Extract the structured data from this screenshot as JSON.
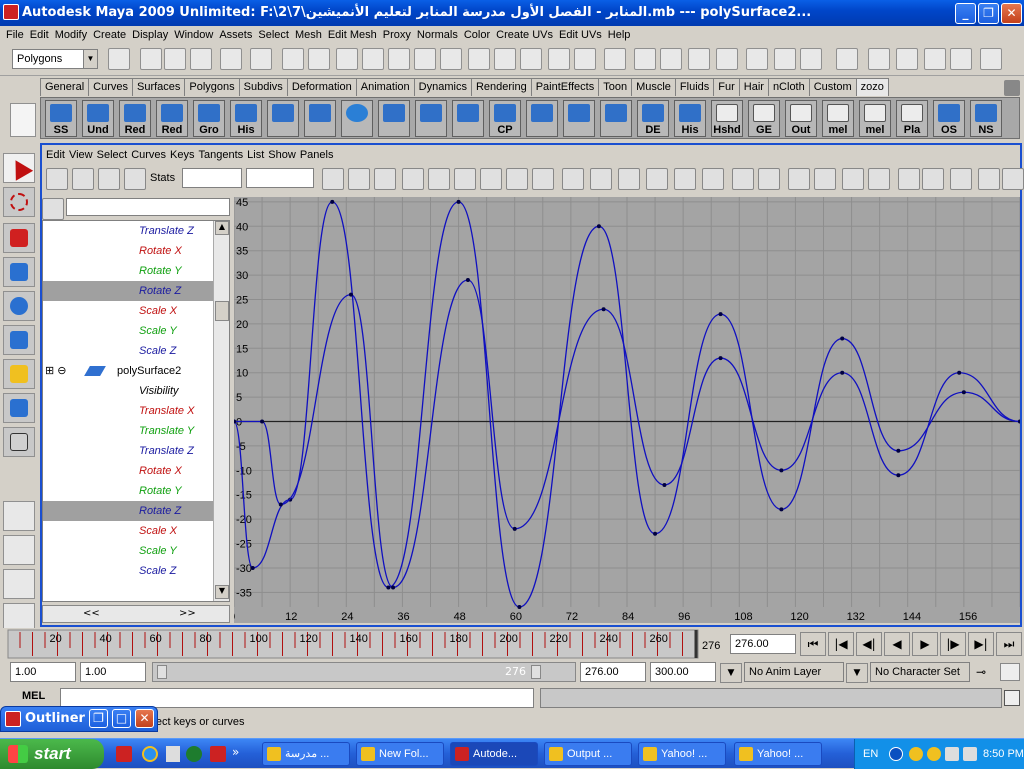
{
  "window": {
    "title": "Autodesk Maya 2009 Unlimited: F:\\2\\7\\المنابر - الفصل الأول مدرسة المنابر لتعليم الأنميشين.mb   ---   polySurface2..."
  },
  "menu": [
    "File",
    "Edit",
    "Modify",
    "Create",
    "Display",
    "Window",
    "Assets",
    "Select",
    "Mesh",
    "Edit Mesh",
    "Proxy",
    "Normals",
    "Color",
    "Create UVs",
    "Edit UVs",
    "Help"
  ],
  "statusline": {
    "menuset": "Polygons"
  },
  "shelf": {
    "tabs": [
      "General",
      "Curves",
      "Surfaces",
      "Polygons",
      "Subdivs",
      "Deformation",
      "Animation",
      "Dynamics",
      "Rendering",
      "PaintEffects",
      "Toon",
      "Muscle",
      "Fluids",
      "Fur",
      "Hair",
      "nCloth",
      "Custom",
      "zozo"
    ],
    "active_tab": "zozo",
    "buttons": [
      "SS",
      "Und",
      "Red",
      "Red",
      "Gro",
      "His",
      "",
      "",
      "",
      "",
      "",
      "",
      "CP",
      "",
      "",
      "",
      "DE",
      "His",
      "Hshd",
      "GE",
      "Out",
      "mel",
      "mel",
      "Pla",
      "OS",
      "NS"
    ]
  },
  "graph_editor": {
    "menu": [
      "Edit",
      "View",
      "Select",
      "Curves",
      "Keys",
      "Tangents",
      "List",
      "Show",
      "Panels"
    ],
    "stats_label": "Stats",
    "outliner_rows": [
      {
        "label": "Translate Z",
        "color": "#1a1aa0",
        "selected": false
      },
      {
        "label": "Rotate X",
        "color": "#c01010",
        "selected": false
      },
      {
        "label": "Rotate Y",
        "color": "#10a010",
        "selected": false
      },
      {
        "label": "Rotate Z",
        "color": "#1a1aa0",
        "selected": true
      },
      {
        "label": "Scale X",
        "color": "#c01010",
        "selected": false
      },
      {
        "label": "Scale Y",
        "color": "#10a010",
        "selected": false
      },
      {
        "label": "Scale Z",
        "color": "#1a1aa0",
        "selected": false
      },
      {
        "label": "polySurface2",
        "color": "#000000",
        "selected": false,
        "node": true
      },
      {
        "label": "Visibility",
        "color": "#000000",
        "selected": false
      },
      {
        "label": "Translate X",
        "color": "#c01010",
        "selected": false
      },
      {
        "label": "Translate Y",
        "color": "#10a010",
        "selected": false
      },
      {
        "label": "Translate Z",
        "color": "#1a1aa0",
        "selected": false
      },
      {
        "label": "Rotate X",
        "color": "#c01010",
        "selected": false
      },
      {
        "label": "Rotate Y",
        "color": "#10a010",
        "selected": false
      },
      {
        "label": "Rotate Z",
        "color": "#1a1aa0",
        "selected": true
      },
      {
        "label": "Scale X",
        "color": "#c01010",
        "selected": false
      },
      {
        "label": "Scale Y",
        "color": "#10a010",
        "selected": false
      },
      {
        "label": "Scale Z",
        "color": "#1a1aa0",
        "selected": false
      }
    ],
    "scroll_left": "<<",
    "scroll_right": ">>"
  },
  "chart_data": {
    "type": "line",
    "x_ticks": [
      0,
      12,
      24,
      36,
      48,
      60,
      72,
      84,
      96,
      108,
      120,
      132,
      144,
      156
    ],
    "y_ticks": [
      45,
      40,
      35,
      30,
      25,
      20,
      15,
      10,
      5,
      0,
      -5,
      -10,
      -15,
      -20,
      -25,
      -30,
      -35
    ],
    "xlim": [
      0,
      168
    ],
    "ylim": [
      -38,
      46
    ],
    "grid": true,
    "series": [
      {
        "color": "#1010c0",
        "points": [
          [
            0,
            0
          ],
          [
            4,
            -30
          ],
          [
            12,
            -16
          ],
          [
            21,
            45
          ],
          [
            33,
            -34
          ],
          [
            48,
            45
          ],
          [
            61,
            -38
          ],
          [
            78,
            40
          ],
          [
            90,
            -23
          ],
          [
            104,
            22
          ],
          [
            117,
            -18
          ],
          [
            130,
            17
          ],
          [
            142,
            -6
          ],
          [
            156,
            6
          ],
          [
            168,
            0
          ]
        ]
      },
      {
        "color": "#1010c0",
        "points": [
          [
            0,
            0
          ],
          [
            6,
            0
          ],
          [
            10,
            -17
          ],
          [
            25,
            26
          ],
          [
            34,
            -34
          ],
          [
            50,
            29
          ],
          [
            60,
            -22
          ],
          [
            79,
            23
          ],
          [
            92,
            -13
          ],
          [
            104,
            13
          ],
          [
            117,
            -10
          ],
          [
            130,
            10
          ],
          [
            142,
            -11
          ],
          [
            155,
            10
          ],
          [
            168,
            0
          ]
        ]
      }
    ]
  },
  "timeline": {
    "ticks": [
      "20",
      "40",
      "60",
      "80",
      "100",
      "120",
      "140",
      "160",
      "180",
      "200",
      "220",
      "240",
      "260"
    ],
    "current_frame": "276",
    "current_field": "276.00"
  },
  "range": {
    "start": "1.00",
    "anim_start": "1.00",
    "handle": "276",
    "end": "276.00",
    "anim_end": "300.00",
    "anim_layer": "No Anim Layer",
    "char_set": "No Character Set"
  },
  "mel": {
    "label": "MEL"
  },
  "help": {
    "text": "Select keys or curves"
  },
  "outliner_window": {
    "title": "Outliner"
  },
  "taskbar": {
    "start": "start",
    "tasks": [
      "مدرسة ...",
      "New Fol...",
      "Autode...",
      "Output ...",
      "Yahoo! ...",
      "Yahoo! ..."
    ],
    "active_task": 2,
    "lang": "EN",
    "clock": "8:50 PM"
  }
}
